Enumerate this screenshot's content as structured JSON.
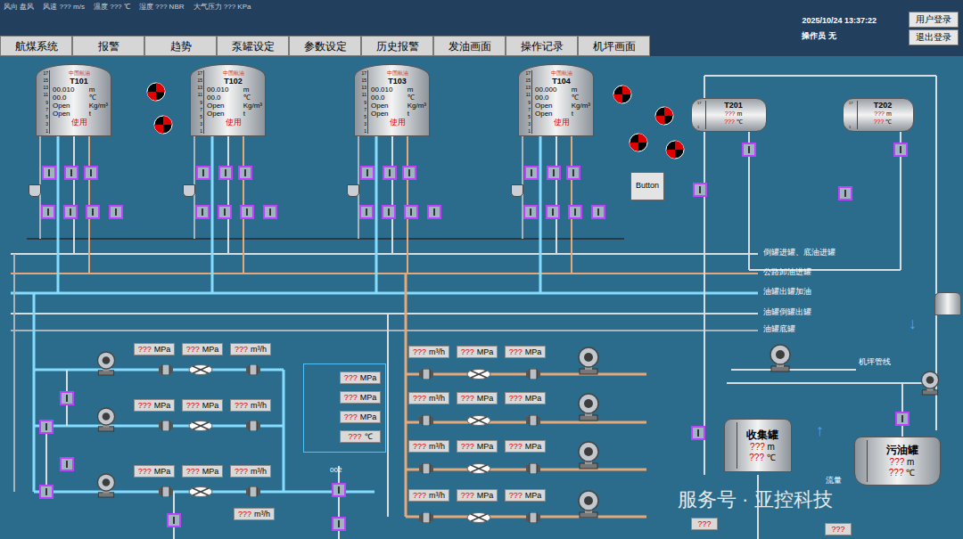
{
  "weather": [
    {
      "label": "风向",
      "value": "盘风",
      "unit": ""
    },
    {
      "label": "风速",
      "value": "???",
      "unit": "m/s"
    },
    {
      "label": "温度",
      "value": "???",
      "unit": "℃"
    },
    {
      "label": "湿度",
      "value": "???",
      "unit": "NBR"
    },
    {
      "label": "大气压力",
      "value": "???",
      "unit": "KPa"
    }
  ],
  "datetime": "2025/10/24 13:37:22",
  "operator": "操作员  无",
  "auth_buttons": [
    "用户登录",
    "退出登录"
  ],
  "nav": [
    {
      "label": "航煤系统",
      "selected": false
    },
    {
      "label": "报警",
      "selected": false
    },
    {
      "label": "趋势",
      "selected": false
    },
    {
      "label": "泵罐设定",
      "selected": false
    },
    {
      "label": "参数设定",
      "selected": false
    },
    {
      "label": "历史报警",
      "selected": false
    },
    {
      "label": "发油画面",
      "selected": false
    },
    {
      "label": "操作记录",
      "selected": false
    },
    {
      "label": "机坪画面",
      "selected": false
    }
  ],
  "tank_logo": "中国航油",
  "tank_scale": [
    "17",
    "15",
    "13",
    "11",
    "9",
    "7",
    "5",
    "3",
    "1"
  ],
  "vertical_tanks": [
    {
      "name": "T101",
      "level": "00.010",
      "level_unit": "m",
      "temp": "00.0",
      "temp_unit": "℃",
      "density": "Open",
      "density_unit": "Kg/m³",
      "mass": "Open",
      "mass_unit": "t",
      "status": "使用"
    },
    {
      "name": "T102",
      "level": "00.010",
      "level_unit": "m",
      "temp": "00.0",
      "temp_unit": "℃",
      "density": "Open",
      "density_unit": "Kg/m³",
      "mass": "Open",
      "mass_unit": "t",
      "status": "使用"
    },
    {
      "name": "T103",
      "level": "00.010",
      "level_unit": "m",
      "temp": "00.0",
      "temp_unit": "℃",
      "density": "Open",
      "density_unit": "Kg/m³",
      "mass": "Open",
      "mass_unit": "t",
      "status": "使用"
    },
    {
      "name": "T104",
      "level": "00.000",
      "level_unit": "m",
      "temp": "00.0",
      "temp_unit": "℃",
      "density": "Open",
      "density_unit": "Kg/m³",
      "mass": "Open",
      "mass_unit": "t",
      "status": "使用"
    }
  ],
  "horizontal_tanks": [
    {
      "name": "T201",
      "level": "???",
      "level_unit": "m",
      "temp": "???",
      "temp_unit": "℃"
    },
    {
      "name": "T202",
      "level": "???",
      "level_unit": "m",
      "temp": "???",
      "temp_unit": "℃"
    }
  ],
  "alarm_lamps": [
    {
      "active": true
    },
    {
      "active": true
    },
    {
      "active": true
    },
    {
      "active": true
    },
    {
      "active": true
    },
    {
      "active": true
    }
  ],
  "button": "Button",
  "pipe_labels": [
    "倒罐进罐、底油进罐",
    "公路卸油进罐",
    "油罐出罐加油",
    "油罐倒罐出罐",
    "油罐底罐"
  ],
  "airport_line": "机坪管线",
  "left_pumps": [
    {
      "readings": [
        {
          "value": "???",
          "unit": "MPa"
        },
        {
          "value": "???",
          "unit": "MPa"
        },
        {
          "value": "???",
          "unit": "m³/h"
        }
      ]
    },
    {
      "readings": [
        {
          "value": "???",
          "unit": "MPa"
        },
        {
          "value": "???",
          "unit": "MPa"
        },
        {
          "value": "???",
          "unit": "m³/h"
        }
      ]
    },
    {
      "readings": [
        {
          "value": "???",
          "unit": "MPa"
        },
        {
          "value": "???",
          "unit": "MPa"
        },
        {
          "value": "???",
          "unit": "m³/h"
        }
      ]
    }
  ],
  "left_panel_readings": [
    {
      "value": "???",
      "unit": "MPa"
    },
    {
      "value": "???",
      "unit": "MPa"
    },
    {
      "value": "???",
      "unit": "MPa"
    },
    {
      "value": "???",
      "unit": "℃"
    }
  ],
  "left_bottom_reading": {
    "value": "???",
    "unit": "m³/h"
  },
  "tag": "002",
  "right_pumps": [
    {
      "readings": [
        {
          "value": "???",
          "unit": "m³/h"
        },
        {
          "value": "???",
          "unit": "MPa"
        },
        {
          "value": "???",
          "unit": "MPa"
        }
      ]
    },
    {
      "readings": [
        {
          "value": "???",
          "unit": "m³/h"
        },
        {
          "value": "???",
          "unit": "MPa"
        },
        {
          "value": "???",
          "unit": "MPa"
        }
      ]
    },
    {
      "readings": [
        {
          "value": "???",
          "unit": "m³/h"
        },
        {
          "value": "???",
          "unit": "MPa"
        },
        {
          "value": "???",
          "unit": "MPa"
        }
      ]
    },
    {
      "readings": [
        {
          "value": "???",
          "unit": "m³/h"
        },
        {
          "value": "???",
          "unit": "MPa"
        },
        {
          "value": "???",
          "unit": "MPa"
        }
      ]
    }
  ],
  "collector": {
    "name": "收集罐",
    "level": "???",
    "level_unit": "m",
    "temp": "???",
    "temp_unit": "℃"
  },
  "slop": {
    "name": "污油罐",
    "level": "???",
    "level_unit": "m",
    "temp": "???",
    "temp_unit": "℃"
  },
  "arrows": [
    "↓",
    "↑"
  ],
  "flow_label": "流量",
  "flow_readings": [
    "???",
    "???"
  ],
  "watermark": "服务号 · 亚控科技"
}
